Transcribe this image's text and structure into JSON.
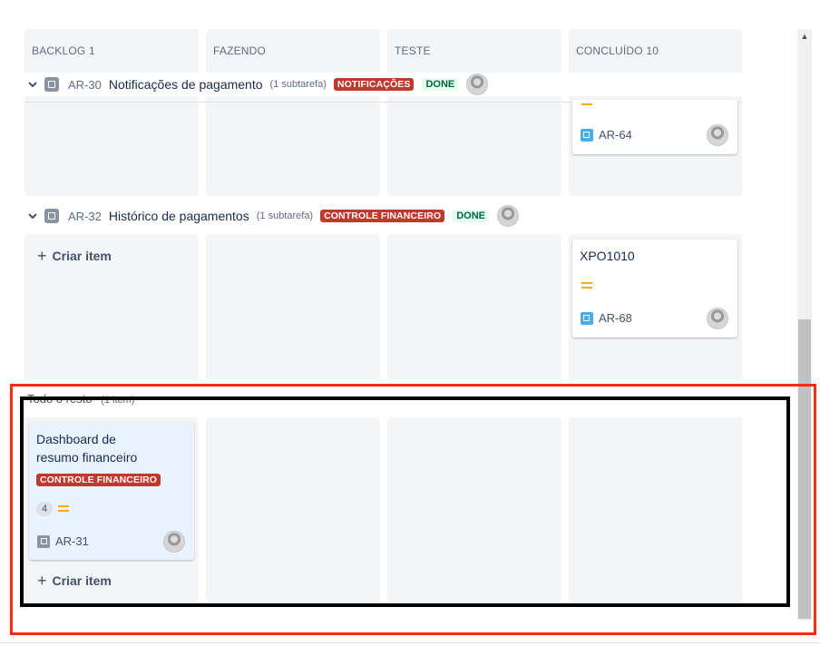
{
  "columns": [
    {
      "label": "BACKLOG 1"
    },
    {
      "label": "FAZENDO"
    },
    {
      "label": "TESTE"
    },
    {
      "label": "CONCLUÍDO 10"
    }
  ],
  "swimlanes": [
    {
      "key": "AR-30",
      "title": "Notificações de pagamento",
      "subtasks": "(1 subtarefa)",
      "label": "NOTIFICAÇÕES",
      "status": "DONE",
      "cards": [
        {
          "key": "AR-64",
          "column": "CONCLUÍDO 10",
          "priority": "medium"
        }
      ]
    },
    {
      "key": "AR-32",
      "title": "Histórico de pagamentos",
      "subtasks": "(1 subtarefa)",
      "label": "CONTROLE FINANCEIRO",
      "status": "DONE",
      "create_label": "Criar item",
      "cards": [
        {
          "title": "XPO1010",
          "key": "AR-68",
          "column": "CONCLUÍDO 10",
          "priority": "medium"
        }
      ]
    }
  ],
  "others": {
    "label": "Todo o resto",
    "count": "(1 item)",
    "create_label": "Criar item",
    "card": {
      "title": "Dashboard de resumo financeiro",
      "label": "CONTROLE FINANCEIRO",
      "estimate": "4",
      "key": "AR-31",
      "priority": "medium"
    }
  },
  "colors": {
    "column_bg": "#f4f5f7",
    "label_red": "#c0392b",
    "done_green": "#006644",
    "priority_medium": "#ffab00",
    "highlight_red": "#ff2a12",
    "highlight_black": "#000000"
  },
  "icons": [
    "chevron-down-icon",
    "story-icon",
    "subtask-icon",
    "task-icon",
    "plus-icon",
    "priority-medium-icon",
    "avatar"
  ]
}
